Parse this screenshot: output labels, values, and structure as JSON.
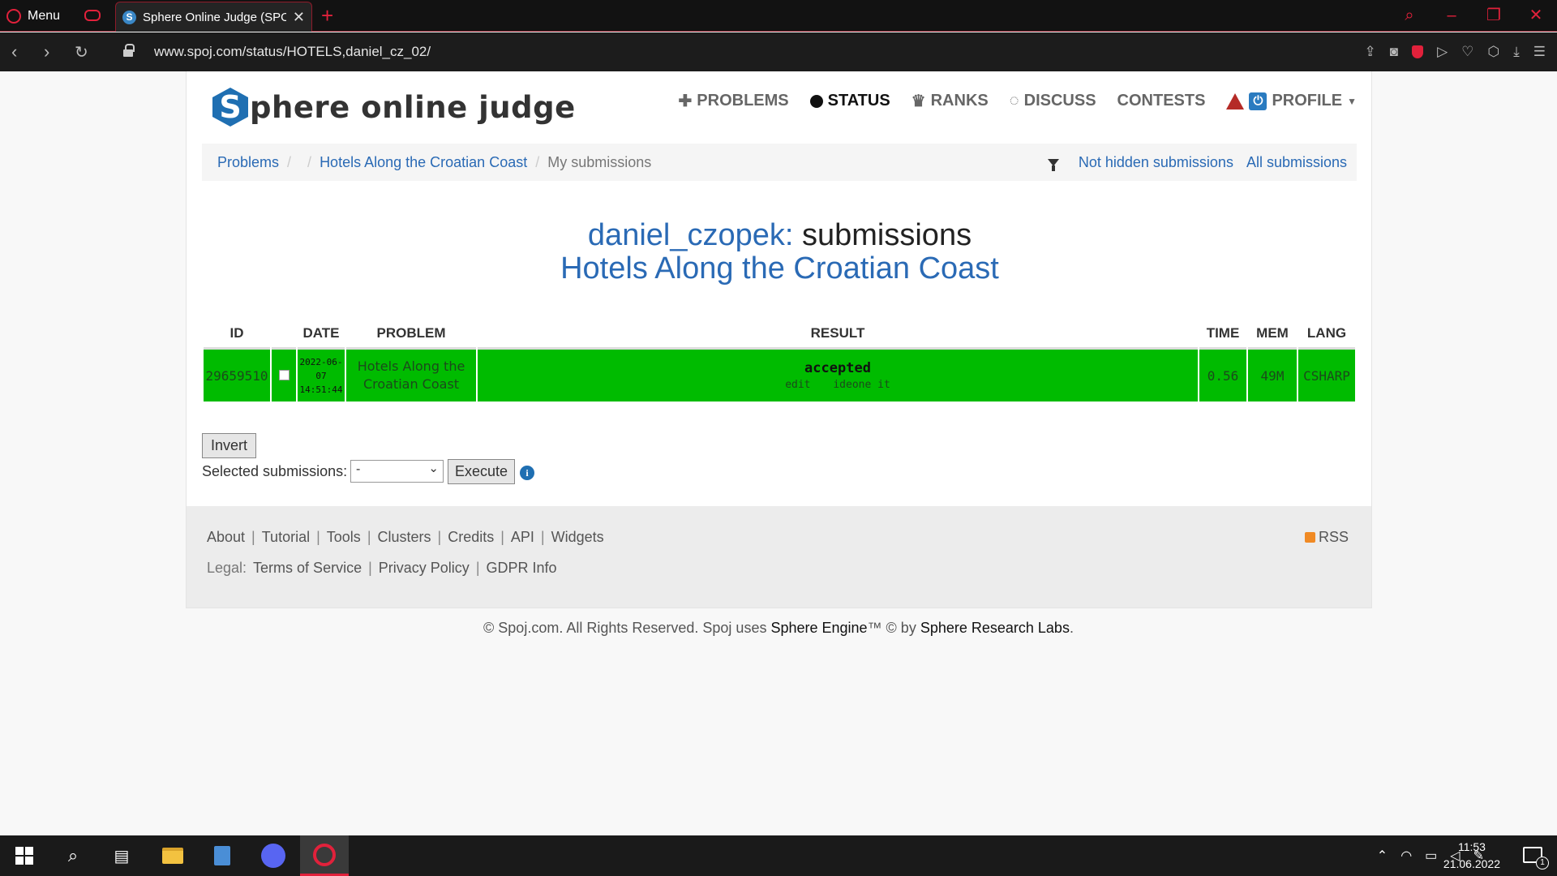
{
  "browser": {
    "menu_label": "Menu",
    "tab_title": "Sphere Online Judge (SPOJ)",
    "tab_favicon": "S",
    "url": "www.spoj.com/status/HOTELS,daniel_cz_02/"
  },
  "site": {
    "logo_letter": "S",
    "logo_text": "phere online judge",
    "nav": {
      "problems": "PROBLEMS",
      "status": "STATUS",
      "ranks": "RANKS",
      "discuss": "DISCUSS",
      "contests": "CONTESTS",
      "profile": "PROFILE"
    }
  },
  "breadcrumb": {
    "problems": "Problems",
    "problem": "Hotels Along the Croatian Coast",
    "current": "My submissions",
    "not_hidden": "Not hidden submissions",
    "all": "All submissions"
  },
  "heading": {
    "user": "daniel_czopek:",
    "suffix": "submissions",
    "problem": "Hotels Along the Croatian Coast"
  },
  "table": {
    "headers": {
      "id": "ID",
      "date": "DATE",
      "problem": "PROBLEM",
      "result": "RESULT",
      "time": "TIME",
      "mem": "MEM",
      "lang": "LANG"
    },
    "rows": [
      {
        "id": "29659510",
        "date": "2022-06-07",
        "time_of_day": "14:51:44",
        "problem": "Hotels Along the Croatian Coast",
        "result": "accepted",
        "edit": "edit",
        "ideone": "ideone it",
        "time": "0.56",
        "mem": "49M",
        "lang": "CSHARP"
      }
    ]
  },
  "actions": {
    "invert": "Invert",
    "selected_label": "Selected submissions:",
    "select_value": "-",
    "execute": "Execute",
    "info": "i"
  },
  "footer": {
    "links": [
      "About",
      "Tutorial",
      "Tools",
      "Clusters",
      "Credits",
      "API",
      "Widgets"
    ],
    "legal_label": "Legal:",
    "legal_links": [
      "Terms of Service",
      "Privacy Policy",
      "GDPR Info"
    ],
    "rss": "RSS",
    "copyright_a": "© Spoj.com. All Rights Reserved. Spoj uses ",
    "copyright_engine": "Sphere Engine",
    "copyright_b": "™ © by ",
    "copyright_labs": "Sphere Research Labs",
    "copyright_c": "."
  },
  "taskbar": {
    "time": "11:53",
    "date": "21.06.2022",
    "notifications": "1"
  },
  "colors": {
    "accepted_green": "#00bb00",
    "link_blue": "#2a6ab5",
    "opera_red": "#e1213b"
  }
}
